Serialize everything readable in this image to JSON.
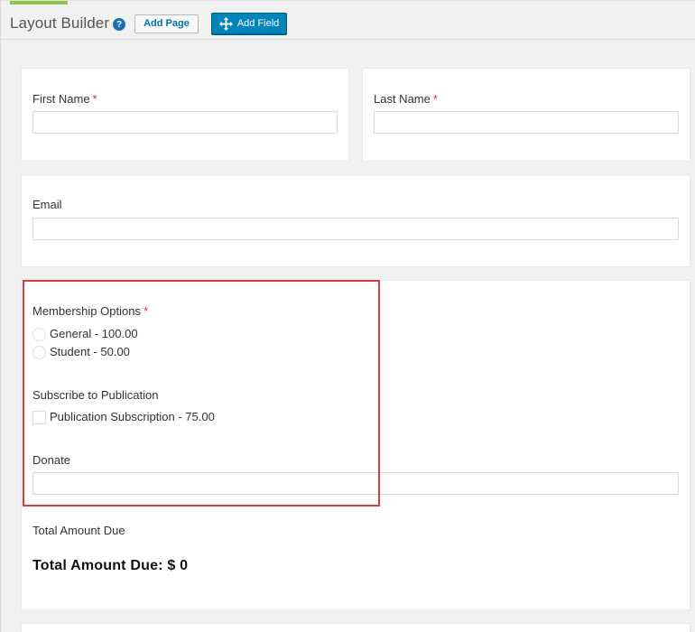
{
  "header": {
    "title": "Layout Builder",
    "help_icon": "?",
    "add_page_label": "Add Page",
    "add_field_label": "Add Field",
    "add_field_icon": "move-icon"
  },
  "fields": {
    "first_name": {
      "label": "First Name",
      "required": "*",
      "value": ""
    },
    "last_name": {
      "label": "Last Name",
      "required": "*",
      "value": ""
    },
    "email": {
      "label": "Email",
      "value": ""
    },
    "membership": {
      "label": "Membership Options",
      "required": "*",
      "options": [
        "General - 100.00",
        "Student - 50.00"
      ]
    },
    "publication": {
      "label": "Subscribe to Publication",
      "options": [
        "Publication Subscription - 75.00"
      ]
    },
    "donate": {
      "label": "Donate",
      "value": ""
    },
    "total": {
      "label": "Total Amount Due",
      "heading": "Total Amount Due: $ 0"
    }
  },
  "colors": {
    "accent": "#0085ba",
    "required": "#e02b2b",
    "highlight": "#e0393e",
    "tab": "#8fc54a"
  }
}
